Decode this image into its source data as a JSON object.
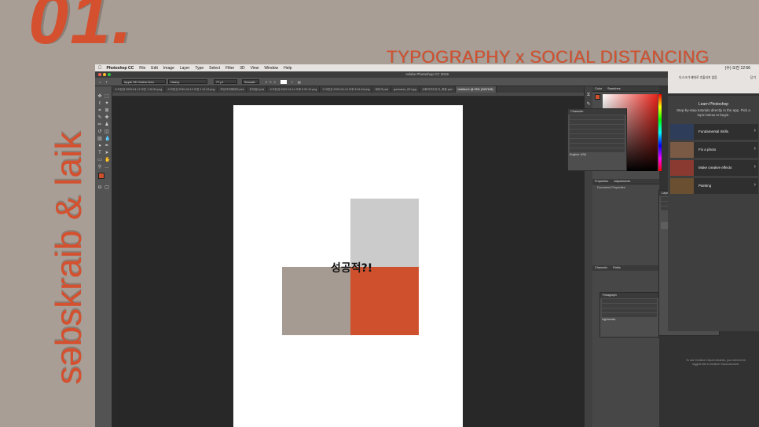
{
  "slide": {
    "number": "01.",
    "title": "TYPOGRAPHY x SOCIAL DISTANCING",
    "vertical_text": "səbskraib & laik"
  },
  "app": {
    "menu": [
      "Photoshop CC",
      "File",
      "Edit",
      "Image",
      "Layer",
      "Type",
      "Select",
      "Filter",
      "3D",
      "View",
      "Window",
      "Help"
    ],
    "window_title": "Adobe Photoshop CC 2019",
    "clock": "(수) 오전 12:56"
  },
  "options_bar": {
    "font_family": "Apple SD Gothic Neo",
    "font_style": "Heavy",
    "font_size": "77 pt",
    "antialias": "Smooth"
  },
  "tabs": [
    "스크린샷 2020-04-12 오전 1.28.52.png",
    "스크린샷 2020-04-12 오전 1.31.23.png",
    "모션크리에이터.psd",
    "우리집2.psd",
    "스크린샷 2020-04-14 오후 9.00.10.png",
    "스크린샷 2020-04-14 오후 8.04.43.png",
    "케이크.psd",
    "goonaraz_001.jpg",
    "사회적거리두기_최종.psd",
    "Untitled-1 @ 33% (CMYK/8)"
  ],
  "document": {
    "text": "성공적?!",
    "colors": {
      "gray": "#cbcbcb",
      "taupe": "#a69b93",
      "orange": "#cf502c"
    }
  },
  "panels": {
    "color": "Color",
    "swatches": "Swatches",
    "character": "Character",
    "properties": "Properties",
    "adjustments": "Adjustments",
    "document_properties": "Document Properties",
    "layers": "Layers",
    "layer_name": "Background",
    "channels": "Channels",
    "paths": "Paths",
    "paragraph": "Paragraph",
    "hyphenate": "Hyphenate",
    "language": "English: USA"
  },
  "learn": {
    "title": "Learn Photoshop",
    "subtitle": "Step-by-step tutorials directly in the app. Pick a topic below to begin.",
    "items": [
      "Fundamental Skills",
      "Fix a photo",
      "Make creative effects",
      "Painting"
    ]
  },
  "notification": {
    "text": "디스크가 제대로 추출되지 않음",
    "button": "닫기"
  },
  "cc_message": "To use Creative Cloud Libraries, you need to be logged into a Creative Cloud account."
}
